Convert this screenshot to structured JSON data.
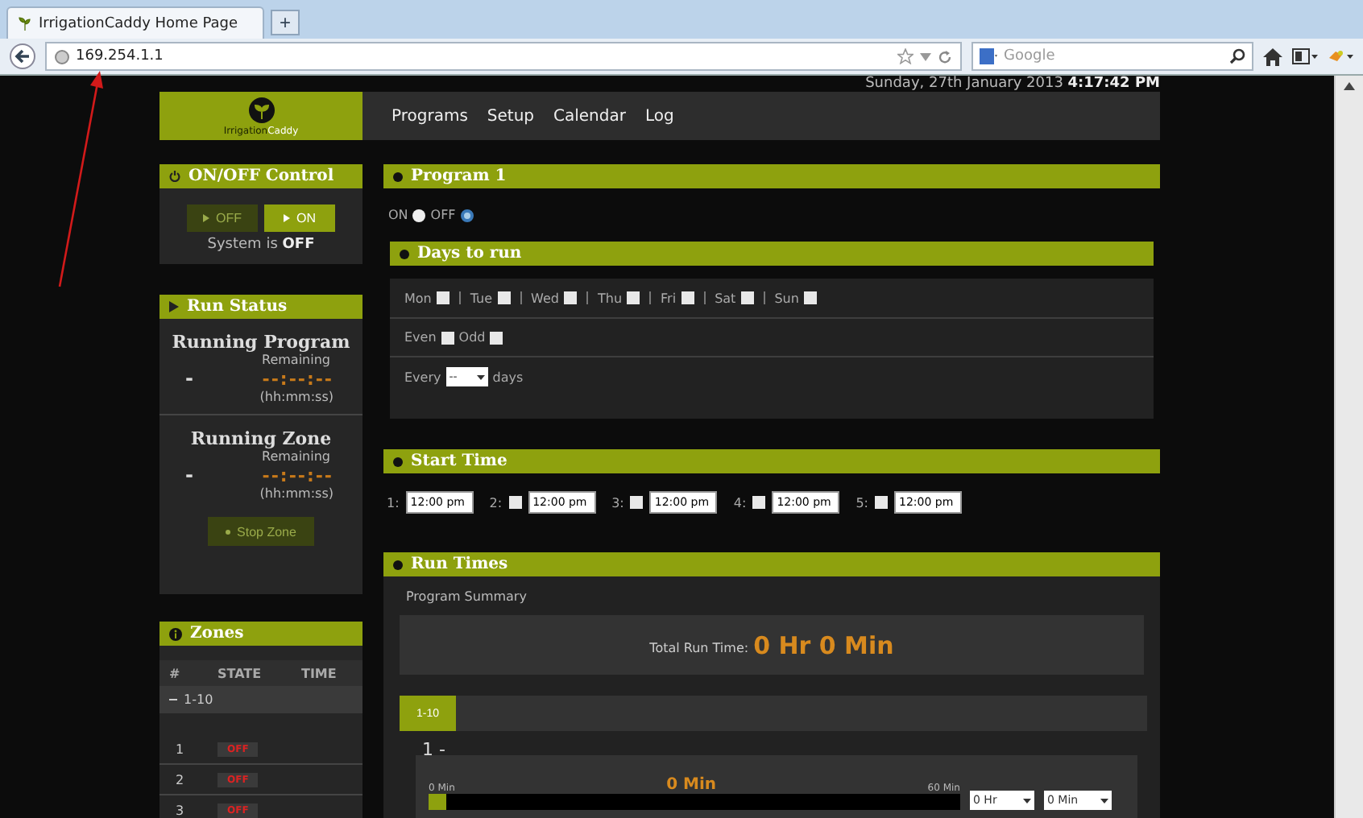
{
  "browser": {
    "tab_title": "IrrigationCaddy Home Page",
    "new_tab": "+",
    "address": "169.254.1.1",
    "search_placeholder": "Google"
  },
  "datetime": {
    "date": "Sunday, 27th January 2013",
    "time": "4:17:42 PM"
  },
  "logo": {
    "words": [
      "Irrigation",
      "Caddy"
    ]
  },
  "nav": [
    "Programs",
    "Setup",
    "Calendar",
    "Log"
  ],
  "onoff": {
    "title": "ON/OFF Control",
    "buttons": [
      {
        "label": "OFF",
        "selected": false
      },
      {
        "label": "ON",
        "selected": true
      }
    ],
    "status_prefix": "System is",
    "status": "OFF"
  },
  "run_status": {
    "title": "Run Status",
    "sections": [
      {
        "title": "Running Program",
        "remaining_label": "Remaining",
        "value": "-",
        "timer": "--:--:--",
        "unit": "(hh:mm:ss)"
      },
      {
        "title": "Running Zone",
        "remaining_label": "Remaining",
        "value": "-",
        "timer": "--:--:--",
        "unit": "(hh:mm:ss)"
      }
    ],
    "stop_button": {
      "label": "Stop Zone",
      "disabled": true
    }
  },
  "zones": {
    "title": "Zones",
    "columns": [
      "#",
      "STATE",
      "TIME"
    ],
    "group": {
      "label": "1-10",
      "expanded": true
    },
    "rows": [
      {
        "number": "1",
        "state": "OFF"
      },
      {
        "number": "2",
        "state": "OFF"
      },
      {
        "number": "3",
        "state": "OFF"
      }
    ]
  },
  "program": {
    "title": "Program 1",
    "radios": [
      {
        "label": "ON",
        "selected": false
      },
      {
        "label": "OFF",
        "selected": true
      }
    ]
  },
  "days": {
    "title": "Days to run",
    "weekdays": [
      {
        "label": "Mon",
        "checked": false
      },
      {
        "label": "Tue",
        "checked": false
      },
      {
        "label": "Wed",
        "checked": false
      },
      {
        "label": "Thu",
        "checked": false
      },
      {
        "label": "Fri",
        "checked": false
      },
      {
        "label": "Sat",
        "checked": false
      },
      {
        "label": "Sun",
        "checked": false
      }
    ],
    "parity": [
      {
        "label": "Even",
        "checked": false
      },
      {
        "label": "Odd",
        "checked": false
      }
    ],
    "every": {
      "prefix": "Every",
      "value": "--",
      "suffix": "days"
    }
  },
  "start_time": {
    "title": "Start Time",
    "slots": [
      {
        "kind": "plain",
        "label": "1:",
        "value": "12:00 pm"
      },
      {
        "kind": "optional",
        "label": "2:",
        "checked": false,
        "value": "12:00 pm"
      },
      {
        "kind": "optional",
        "label": "3:",
        "checked": false,
        "value": "12:00 pm"
      },
      {
        "kind": "optional",
        "label": "4:",
        "checked": false,
        "value": "12:00 pm"
      },
      {
        "kind": "optional",
        "label": "5:",
        "checked": false,
        "value": "12:00 pm"
      }
    ]
  },
  "run_times": {
    "title": "Run Times",
    "summary_legend": "Program Summary",
    "total_label": "Total Run Time:",
    "total_value": "0 Hr 0 Min",
    "tabs": [
      {
        "label": "1-10",
        "selected": true
      }
    ],
    "zone": {
      "title": "1 -",
      "min_label": "0 Min",
      "value": "0 Min",
      "max_label": "60 Min",
      "level": 0,
      "hours": "0 Hr",
      "minutes": "0 Min"
    }
  }
}
